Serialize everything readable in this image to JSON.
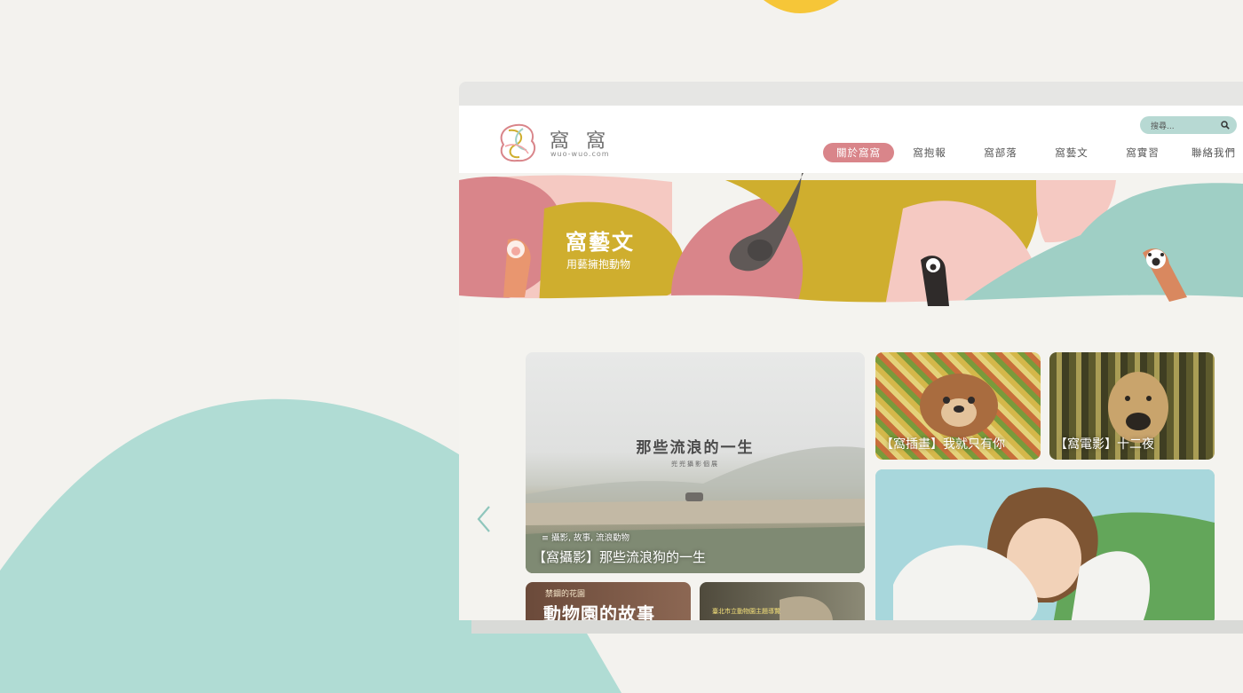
{
  "brand": {
    "name": "窩 窩",
    "domain": "wuo-wuo.com"
  },
  "search": {
    "placeholder": "搜尋..."
  },
  "nav": {
    "items": [
      "關於窩窩",
      "窩抱報",
      "窩部落",
      "窩藝文",
      "窩實習",
      "聯絡我們"
    ],
    "active": "關於窩窩"
  },
  "hero": {
    "title": "窩藝文",
    "subtitle": "用藝擁抱動物"
  },
  "featured": {
    "poster_title": "那些流浪的一生",
    "poster_subtitle": "兜兜攝影個展",
    "tags": "≡ 攝影, 故事, 流浪動物",
    "title": "【窩攝影】那些流浪狗的一生"
  },
  "cards": [
    {
      "title": "【窩插畫】我就只有你"
    },
    {
      "title": "【窩電影】十二夜"
    }
  ],
  "small_cards": [
    {
      "label": "禁錮的花園",
      "headline": "動物園的故事"
    },
    {
      "label": "臺北市立動物園主題導覽"
    }
  ],
  "colors": {
    "accent_pink": "#d9858a",
    "mustard": "#cfae2e",
    "teal": "#9fcfc5",
    "peach": "#f5c9c2",
    "background": "#f3f2ee"
  }
}
